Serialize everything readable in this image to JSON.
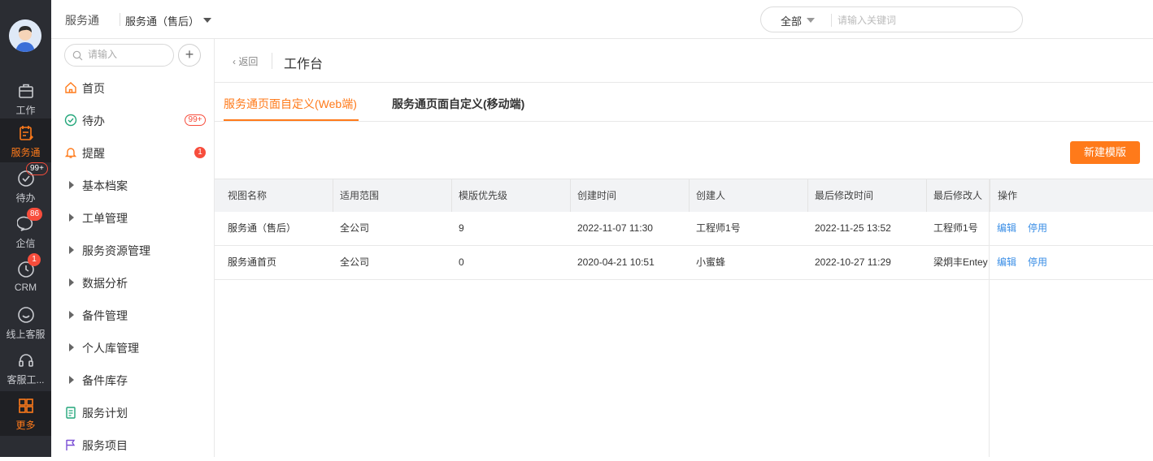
{
  "rail": {
    "items": [
      {
        "label": "工作",
        "icon": "briefcase-icon",
        "active": false,
        "badge": ""
      },
      {
        "label": "服务通",
        "icon": "service-icon",
        "active": true,
        "badge": ""
      },
      {
        "label": "待办",
        "icon": "check-circle-icon",
        "active": false,
        "badge": "99+"
      },
      {
        "label": "企信",
        "icon": "chat-icon",
        "active": false,
        "badge": "86"
      },
      {
        "label": "CRM",
        "icon": "clock-icon",
        "active": false,
        "badge": "1"
      },
      {
        "label": "线上客服",
        "icon": "smile-chat-icon",
        "active": false,
        "badge": ""
      },
      {
        "label": "客服工...",
        "icon": "headset-icon",
        "active": false,
        "badge": ""
      },
      {
        "label": "更多",
        "icon": "grid-icon",
        "active": true,
        "badge": ""
      }
    ]
  },
  "topbar": {
    "app_title": "服务通",
    "app_select": "服务通（售后）",
    "search_scope": "全部",
    "search_placeholder": "请输入关键词"
  },
  "sidebar": {
    "search_placeholder": "请输入",
    "add_label": "+",
    "items": [
      {
        "label": "首页",
        "icon": "home-icon",
        "badge": ""
      },
      {
        "label": "待办",
        "icon": "check-circle-icon",
        "badge": "99+"
      },
      {
        "label": "提醒",
        "icon": "bell-icon",
        "badge": "1"
      },
      {
        "label": "基本档案",
        "icon": "triangle-right-icon",
        "badge": ""
      },
      {
        "label": "工单管理",
        "icon": "triangle-right-icon",
        "badge": ""
      },
      {
        "label": "服务资源管理",
        "icon": "triangle-right-icon",
        "badge": ""
      },
      {
        "label": "数据分析",
        "icon": "triangle-right-icon",
        "badge": ""
      },
      {
        "label": "备件管理",
        "icon": "triangle-right-icon",
        "badge": ""
      },
      {
        "label": "个人库管理",
        "icon": "triangle-right-icon",
        "badge": ""
      },
      {
        "label": "备件库存",
        "icon": "triangle-right-icon",
        "badge": ""
      },
      {
        "label": "服务计划",
        "icon": "clipboard-icon",
        "badge": ""
      },
      {
        "label": "服务项目",
        "icon": "flag-icon",
        "badge": ""
      }
    ]
  },
  "header": {
    "back_label": "返回",
    "page_title": "工作台"
  },
  "tabs": [
    {
      "label": "服务通页面自定义(Web端)",
      "active": true
    },
    {
      "label": "服务通页面自定义(移动端)",
      "active": false
    }
  ],
  "new_button_label": "新建模版",
  "table": {
    "columns": [
      "视图名称",
      "适用范围",
      "模版优先级",
      "创建时间",
      "创建人",
      "最后修改时间",
      "最后修改人",
      "操作"
    ],
    "rows": [
      [
        "服务通（售后）",
        "全公司",
        "9",
        "2022-11-07 11:30",
        "工程师1号",
        "2022-11-25 13:52",
        "工程师1号"
      ],
      [
        "服务通首页",
        "全公司",
        "0",
        "2020-04-21 10:51",
        "小蜜蜂",
        "2022-10-27 11:29",
        "梁炯丰Entey"
      ]
    ],
    "actions": [
      "编辑",
      "停用"
    ]
  },
  "colors": {
    "accent": "#ff7a1a",
    "rail_bg": "#2b2d33",
    "link": "#3a8ee6",
    "badge": "#f74d3c"
  }
}
